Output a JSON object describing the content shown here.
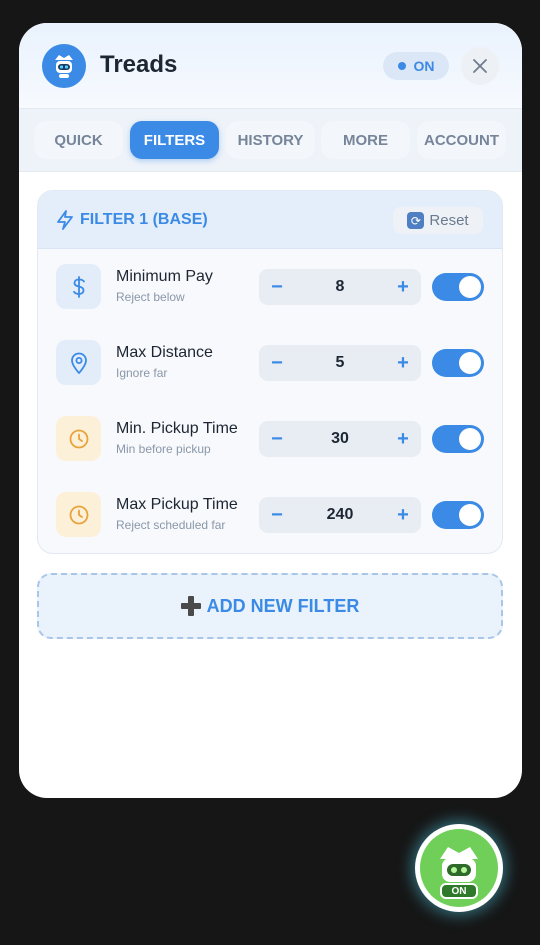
{
  "app": {
    "title": "Treads",
    "status_label": "ON"
  },
  "tabs": [
    {
      "label": "QUICK"
    },
    {
      "label": "FILTERS"
    },
    {
      "label": "HISTORY"
    },
    {
      "label": "MORE"
    },
    {
      "label": "ACCOUNT"
    }
  ],
  "active_tab": "FILTERS",
  "filter_card": {
    "title": "FILTER 1 (BASE)",
    "reset_label": "Reset",
    "rows": [
      {
        "label": "Minimum Pay",
        "sublabel": "Reject below",
        "value": "8",
        "icon": "dollar-icon",
        "minus": "−",
        "plus": "+",
        "enabled": true
      },
      {
        "label": "Max Distance",
        "sublabel": "Ignore far",
        "value": "5",
        "icon": "map-pin-icon",
        "minus": "−",
        "plus": "+",
        "enabled": true
      },
      {
        "label": "Min. Pickup Time",
        "sublabel": "Min before pickup",
        "value": "30",
        "icon": "clock-icon",
        "minus": "−",
        "plus": "+",
        "enabled": true
      },
      {
        "label": "Max Pickup Time",
        "sublabel": "Reject scheduled far",
        "value": "240",
        "icon": "clock-icon",
        "minus": "−",
        "plus": "+",
        "enabled": true
      }
    ]
  },
  "add_filter_label": "ADD NEW FILTER",
  "fab": {
    "badge": "ON"
  },
  "colors": {
    "accent": "#3a8ae6",
    "warning_icon": "#e8a33b",
    "fab_green": "#6fcf58"
  }
}
